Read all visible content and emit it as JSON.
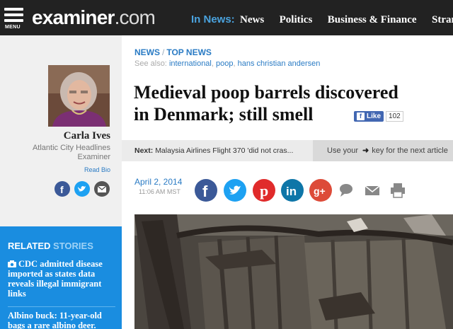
{
  "header": {
    "menu_label": "MENU",
    "logo_main": "examiner",
    "logo_suffix": ".com",
    "in_news_label": "In News:",
    "nav": [
      "News",
      "Politics",
      "Business & Finance",
      "Stran"
    ]
  },
  "author": {
    "name": "Carla Ives",
    "role": "Atlantic City Headlines Examiner",
    "read_bio": "Read Bio"
  },
  "related": {
    "title_strong": "RELATED",
    "title_rest": " STORIES",
    "stories": [
      "CDC admitted disease imported as states data reveals illegal immigrant links",
      "Albino buck: 11-year-old bags a rare albino deer."
    ]
  },
  "article": {
    "breadcrumb": [
      "NEWS",
      "TOP NEWS"
    ],
    "see_also_label": "See also:",
    "see_also_links": [
      "international",
      "poop",
      "hans christian andersen"
    ],
    "headline_line1": "Medieval poop barrels discovered",
    "headline_line2": "in Denmark; still smell",
    "like_label": "Like",
    "like_count": "102",
    "next_label": "Next:",
    "next_title": "Malaysia Airlines Flight 370 'did not cras...",
    "kbd_hint_pre": "Use your",
    "kbd_hint_post": "key for the next article",
    "date": "April 2, 2014",
    "time": "11:06 AM MST"
  },
  "colors": {
    "topbar": "#222222",
    "accent_blue": "#2a7bc4",
    "related_bg": "#1a8de0",
    "facebook": "#3b5998",
    "twitter": "#1da1f2",
    "pinterest": "#e02b2b",
    "linkedin": "#0e76a8",
    "googleplus": "#dd4b39"
  }
}
